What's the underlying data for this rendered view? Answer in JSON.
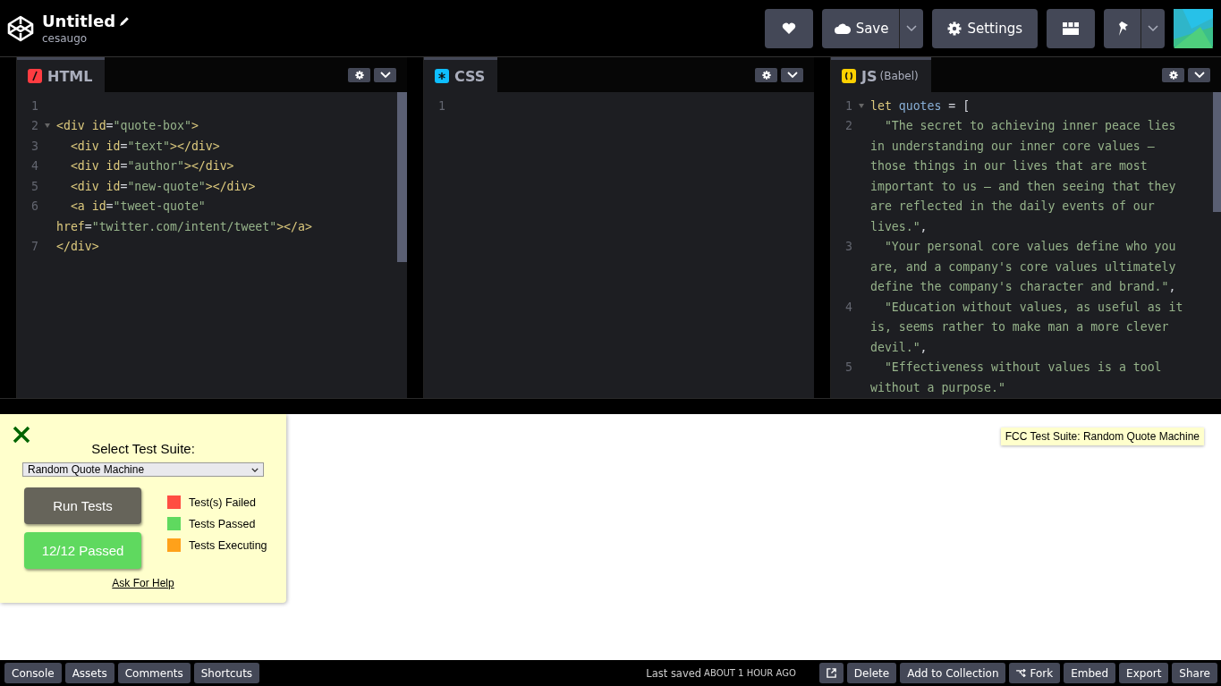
{
  "header": {
    "title": "Untitled",
    "author": "cesaugo",
    "actions": [
      {
        "kind": "heart"
      },
      {
        "kind": "save",
        "label": "Save"
      },
      {
        "kind": "settings",
        "label": "Settings"
      },
      {
        "kind": "layout"
      },
      {
        "kind": "pin"
      }
    ]
  },
  "editors": [
    {
      "kind": "html",
      "label": "HTML",
      "lines": [
        {
          "number": "1",
          "fold": false
        },
        {
          "number": "2",
          "fold": true,
          "tokens": [
            {
              "kind": "tag",
              "text": "<div"
            },
            {
              "kind": "attr",
              "text": " id"
            },
            {
              "kind": "plain",
              "text": "="
            },
            {
              "kind": "string",
              "text": "\"quote-box\""
            },
            {
              "kind": "tag",
              "text": ">"
            }
          ]
        },
        {
          "number": "3",
          "fold": false,
          "tokens": [
            {
              "kind": "tag",
              "text": "  <div"
            },
            {
              "kind": "attr",
              "text": " id"
            },
            {
              "kind": "plain",
              "text": "="
            },
            {
              "kind": "string",
              "text": "\"text\""
            },
            {
              "kind": "tag",
              "text": "></div>"
            }
          ]
        },
        {
          "number": "4",
          "fold": false,
          "tokens": [
            {
              "kind": "tag",
              "text": "  <div"
            },
            {
              "kind": "attr",
              "text": " id"
            },
            {
              "kind": "plain",
              "text": "="
            },
            {
              "kind": "string",
              "text": "\"author\""
            },
            {
              "kind": "tag",
              "text": "></div>"
            }
          ]
        },
        {
          "number": "5",
          "fold": false,
          "tokens": [
            {
              "kind": "tag",
              "text": "  <div"
            },
            {
              "kind": "attr",
              "text": " id"
            },
            {
              "kind": "plain",
              "text": "="
            },
            {
              "kind": "string",
              "text": "\"new-quote\""
            },
            {
              "kind": "tag",
              "text": "></div>"
            }
          ]
        },
        {
          "number": "6",
          "fold": false,
          "tokens": [
            {
              "kind": "tag",
              "text": "  <a"
            },
            {
              "kind": "attr",
              "text": " id"
            },
            {
              "kind": "plain",
              "text": "="
            },
            {
              "kind": "string",
              "text": "\"tweet-quote\""
            }
          ]
        },
        {
          "fold": false,
          "tokens": [
            {
              "kind": "attr",
              "text": "href"
            },
            {
              "kind": "plain",
              "text": "="
            },
            {
              "kind": "string",
              "text": "\"twitter.com/intent/tweet\""
            },
            {
              "kind": "tag",
              "text": "></a>"
            }
          ]
        },
        {
          "number": "7",
          "fold": false,
          "tokens": [
            {
              "kind": "tag",
              "text": "</div>"
            }
          ]
        }
      ]
    },
    {
      "kind": "css",
      "label": "CSS",
      "lines": [
        {
          "number": "1",
          "fold": false
        }
      ]
    },
    {
      "kind": "js",
      "label": "JS",
      "sublabel": "(Babel)",
      "lines": [
        {
          "number": "1",
          "fold": true,
          "tokens": [
            {
              "kind": "keyword",
              "text": "let"
            },
            {
              "kind": "variable",
              "text": " quotes"
            },
            {
              "kind": "plain",
              "text": " = ["
            }
          ]
        },
        {
          "number": "2",
          "fold": false,
          "tokens": [
            {
              "kind": "string",
              "text": "  \"The secret to achieving inner peace lies"
            }
          ]
        },
        {
          "fold": false,
          "tokens": [
            {
              "kind": "string",
              "text": "in understanding our inner core values –"
            }
          ]
        },
        {
          "fold": false,
          "tokens": [
            {
              "kind": "string",
              "text": "those things in our lives that are most"
            }
          ]
        },
        {
          "fold": false,
          "tokens": [
            {
              "kind": "string",
              "text": "important to us – and then seeing that they"
            }
          ]
        },
        {
          "fold": false,
          "tokens": [
            {
              "kind": "string",
              "text": "are reflected in the daily events of our"
            }
          ]
        },
        {
          "fold": false,
          "tokens": [
            {
              "kind": "string",
              "text": "lives.\""
            },
            {
              "kind": "plain",
              "text": ","
            }
          ]
        },
        {
          "number": "3",
          "fold": false,
          "tokens": [
            {
              "kind": "string",
              "text": "  \"Your personal core values define who you"
            }
          ]
        },
        {
          "fold": false,
          "tokens": [
            {
              "kind": "string",
              "text": "are, and a company's core values ultimately"
            }
          ]
        },
        {
          "fold": false,
          "tokens": [
            {
              "kind": "string",
              "text": "define the company's character and brand.\""
            },
            {
              "kind": "plain",
              "text": ","
            }
          ]
        },
        {
          "number": "4",
          "fold": false,
          "tokens": [
            {
              "kind": "string",
              "text": "  \"Education without values, as useful as it"
            }
          ]
        },
        {
          "fold": false,
          "tokens": [
            {
              "kind": "string",
              "text": "is, seems rather to make man a more clever"
            }
          ]
        },
        {
          "fold": false,
          "tokens": [
            {
              "kind": "string",
              "text": "devil.\""
            },
            {
              "kind": "plain",
              "text": ","
            }
          ]
        },
        {
          "number": "5",
          "fold": false,
          "tokens": [
            {
              "kind": "string",
              "text": "  \"Effectiveness without values is a tool"
            }
          ]
        },
        {
          "fold": false,
          "tokens": [
            {
              "kind": "string",
              "text": "without a purpose.\""
            }
          ]
        }
      ]
    }
  ],
  "test_panel": {
    "heading": "Select Test Suite:",
    "suite": "Random Quote Machine",
    "run_button": "Run Tests",
    "result_button": "12/12 Passed",
    "legend": [
      {
        "label": "Test(s) Failed",
        "color": "#ff4e42"
      },
      {
        "label": "Tests Passed",
        "color": "#5fd95f"
      },
      {
        "label": "Tests Executing",
        "color": "#ffa11a"
      }
    ],
    "help_link": "Ask For Help"
  },
  "tooltip": "FCC Test Suite: Random Quote Machine",
  "footer": {
    "left": [
      "Console",
      "Assets",
      "Comments",
      "Shortcuts"
    ],
    "last_saved": "Last saved",
    "saved_time": "ABOUT 1 HOUR AGO",
    "right": [
      {
        "kind": "external"
      },
      {
        "kind": "text",
        "label": "Delete"
      },
      {
        "kind": "text",
        "label": "Add to Collection"
      },
      {
        "kind": "fork",
        "label": "Fork"
      },
      {
        "kind": "text",
        "label": "Embed"
      },
      {
        "kind": "text",
        "label": "Export"
      },
      {
        "kind": "text",
        "label": "Share"
      }
    ]
  }
}
